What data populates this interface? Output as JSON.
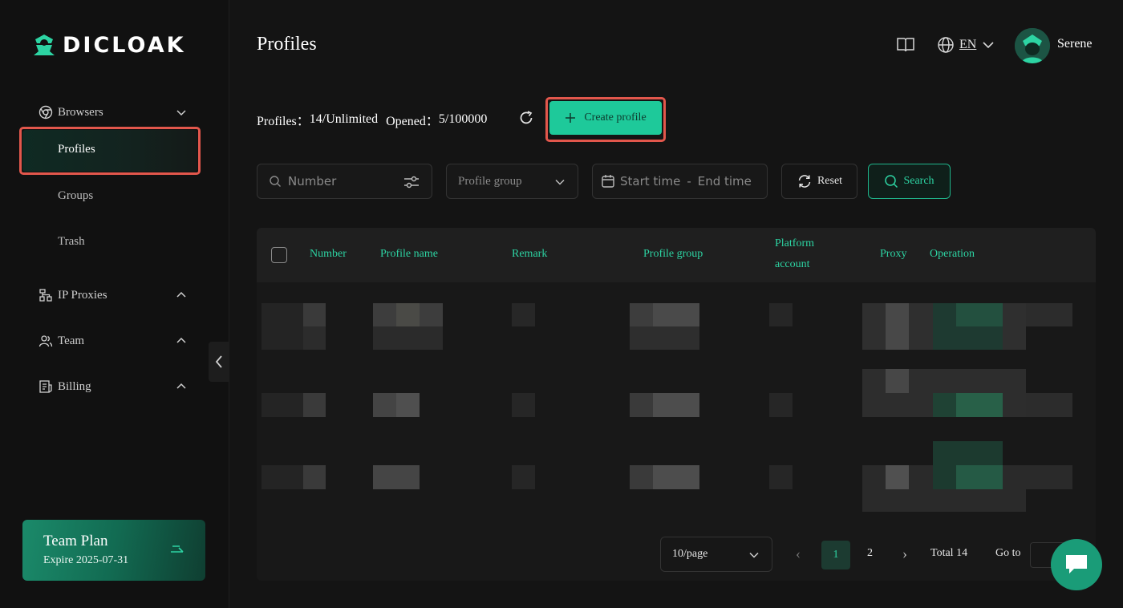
{
  "app": {
    "logo_text": "DICLOAK"
  },
  "sidebar": {
    "browsers": {
      "label": "Browsers",
      "items": [
        {
          "label": "Profiles"
        },
        {
          "label": "Groups"
        },
        {
          "label": "Trash"
        }
      ]
    },
    "ip_proxies": {
      "label": "IP Proxies"
    },
    "team": {
      "label": "Team"
    },
    "billing": {
      "label": "Billing"
    },
    "plan": {
      "title": "Team Plan",
      "expire": "Expire 2025-07-31"
    }
  },
  "header": {
    "title": "Profiles",
    "language": "EN",
    "username": "Serene"
  },
  "stats": {
    "profiles_label": "Profiles：",
    "profiles_value": "14/Unlimited",
    "opened_label": "Opened：",
    "opened_value": "5/100000",
    "create_label": "Create profile"
  },
  "filters": {
    "number_placeholder": "Number",
    "group_placeholder": "Profile group",
    "start_placeholder": "Start time",
    "date_sep": "-",
    "end_placeholder": "End time",
    "reset_label": "Reset",
    "search_label": "Search"
  },
  "table": {
    "columns": {
      "number": "Number",
      "profile_name": "Profile name",
      "remark": "Remark",
      "profile_group": "Profile group",
      "platform_line1": "Platform",
      "platform_line2": "account",
      "proxy": "Proxy",
      "operation": "Operation"
    }
  },
  "pagination": {
    "per_page": "10/page",
    "prev": "‹",
    "pages": [
      "1",
      "2"
    ],
    "next": "›",
    "total": "Total 14",
    "goto_label": "Go to"
  },
  "colors": {
    "accent": "#1ec99a",
    "highlight": "#e2574c",
    "background": "#141414"
  }
}
